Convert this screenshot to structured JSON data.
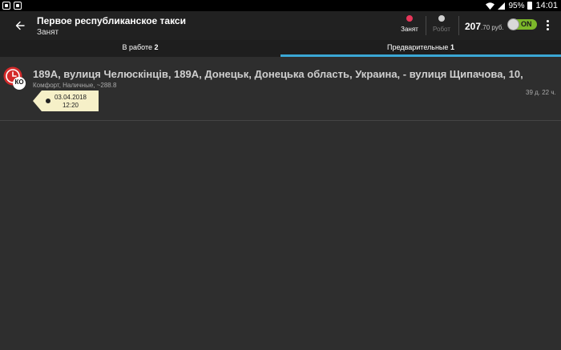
{
  "statusbar": {
    "battery": "95%",
    "time": "14:01"
  },
  "appbar": {
    "title": "Первое республиканское такси",
    "subtitle": "Занят",
    "status_busy": {
      "label": "Занят",
      "color": "#e8365a"
    },
    "status_robot": {
      "label": "Робот",
      "color": "#cfcfcf"
    },
    "balance": {
      "amount": "207",
      "cents": ".70 руб."
    },
    "toggle": {
      "label": "ON",
      "state": "on",
      "color": "#7cb82a"
    }
  },
  "tabs": [
    {
      "label": "В работе",
      "count": "2",
      "active": false
    },
    {
      "label": "Предварительные",
      "count": "1",
      "active": true
    }
  ],
  "colors": {
    "accent": "#3aa7d5",
    "background": "#2e2e2e"
  },
  "order": {
    "icon": "alarm-clock-icon",
    "badge": "КО",
    "address": "189А, вулиця Челюскінців, 189А, Донецьк, Донецька область, Украина, - вулиця Щипачова, 10,",
    "details": "Комфорт, Наличные, ~288.8",
    "timer": "39 д. 22 ч.",
    "date": "03.04.2018",
    "time": "12:20"
  }
}
